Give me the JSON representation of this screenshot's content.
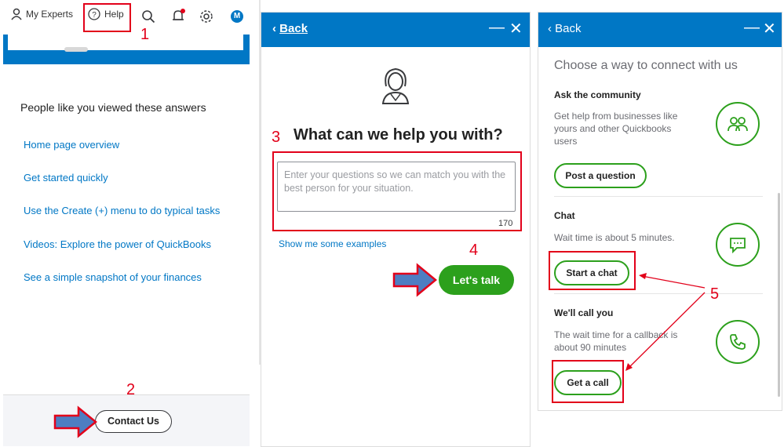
{
  "panel1": {
    "topbar": {
      "my_experts": "My Experts",
      "help": "Help",
      "avatar_initial": "M"
    },
    "heading": "People like you viewed these answers",
    "links": [
      "Home page overview",
      "Get started quickly",
      "Use the Create (+) menu to do typical tasks",
      "Videos: Explore the power of QuickBooks",
      "See a simple snapshot of your finances"
    ],
    "contact_button": "Contact Us"
  },
  "panel2": {
    "back": "Back",
    "minimize": "—",
    "close": "✕",
    "title": "What can we help you with?",
    "textarea_placeholder": "Enter your questions so we can match you with the best person for your situation.",
    "char_count": "170",
    "examples_link": "Show me some examples",
    "talk_button": "Let's talk"
  },
  "panel3": {
    "back": "Back",
    "minimize": "—",
    "close": "✕",
    "title": "Choose a way to connect with us",
    "community": {
      "title": "Ask the community",
      "desc": "Get help from businesses like yours and other Quickbooks users",
      "button": "Post a question"
    },
    "chat": {
      "title": "Chat",
      "desc": "Wait time is about 5 minutes.",
      "button": "Start a chat"
    },
    "call": {
      "title": "We'll call you",
      "desc": "The wait time for a callback is about 90 minutes",
      "button": "Get a call"
    }
  },
  "annotations": {
    "step1": "1",
    "step2": "2",
    "step3": "3",
    "step4": "4",
    "step5": "5"
  },
  "colors": {
    "brand_blue": "#0077c5",
    "green": "#2ca01c",
    "annotation_red": "#e2001a"
  }
}
